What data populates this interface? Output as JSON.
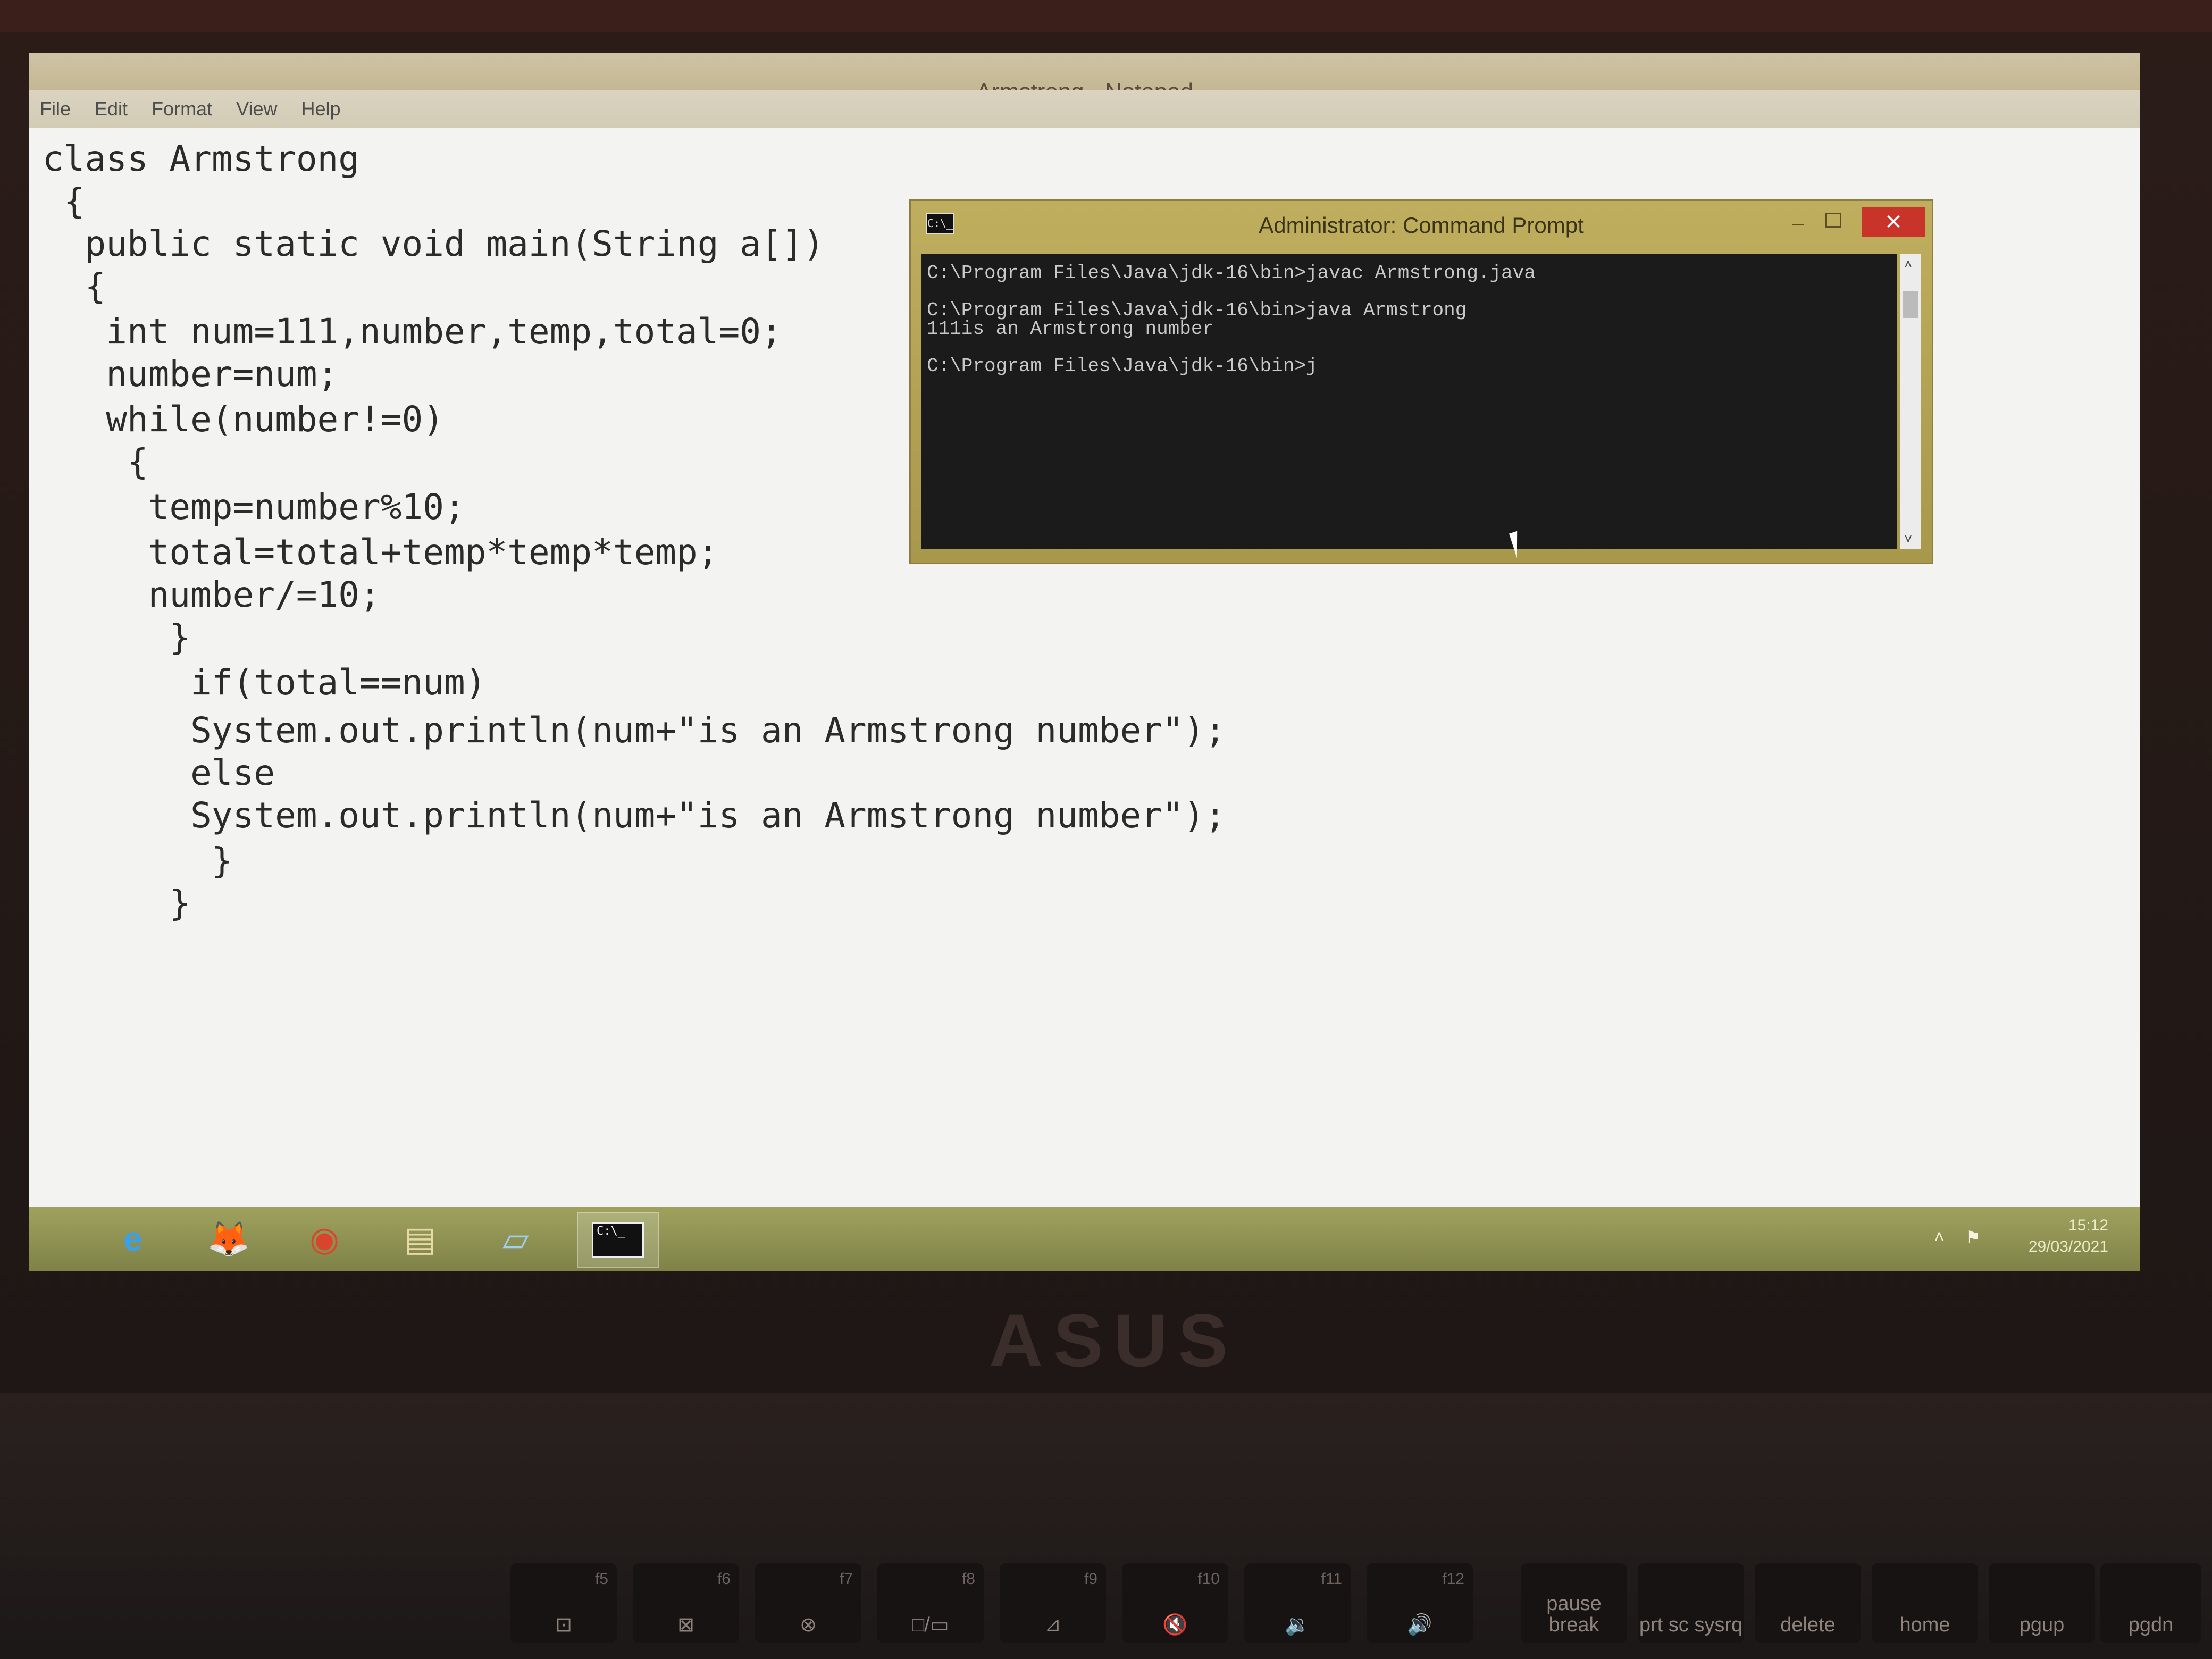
{
  "notepad": {
    "title": "Armstrong - Notepad",
    "menu": [
      "File",
      "Edit",
      "Format",
      "View",
      "Help"
    ],
    "code_lines": [
      "class Armstrong",
      " {",
      "  public static void main(String a[])",
      "  {",
      "   int num=111,number,temp,total=0;",
      "   number=num;",
      "   while(number!=0)",
      "    {",
      "     temp=number%10;",
      "     total=total+temp*temp*temp;",
      "     number/=10;",
      "      }",
      "       if(total==num)",
      "       System.out.println(num+\"is an Armstrong number\");",
      "       else",
      "       System.out.println(num+\"is an Armstrong number\");",
      "        }",
      "      }"
    ]
  },
  "cmd": {
    "title": "Administrator: Command Prompt",
    "icon_label": "C:\\_",
    "close_label": "✕",
    "lines": [
      "C:\\Program Files\\Java\\jdk-16\\bin>javac Armstrong.java",
      "",
      "C:\\Program Files\\Java\\jdk-16\\bin>java Armstrong",
      "111is an Armstrong number",
      "",
      "C:\\Program Files\\Java\\jdk-16\\bin>j"
    ]
  },
  "taskbar": {
    "items": [
      {
        "name": "internet-explorer",
        "glyph": "e"
      },
      {
        "name": "firefox",
        "glyph": "🦊"
      },
      {
        "name": "chrome",
        "glyph": "◉"
      },
      {
        "name": "file-explorer",
        "glyph": "▤"
      },
      {
        "name": "notepad",
        "glyph": "▱"
      },
      {
        "name": "command-prompt",
        "glyph": "C:\\_"
      }
    ],
    "time": "15:12",
    "date": "29/03/2021"
  },
  "brand": "ASUS",
  "keyboard": {
    "keys": [
      {
        "fn": "f5",
        "sym": "⊡"
      },
      {
        "fn": "f6",
        "sym": "⊠"
      },
      {
        "fn": "f7",
        "sym": "⊗"
      },
      {
        "fn": "f8",
        "sym": "□/▭"
      },
      {
        "fn": "f9",
        "sym": "⊿"
      },
      {
        "fn": "f10",
        "sym": "🔇"
      },
      {
        "fn": "f11",
        "sym": "🔉"
      },
      {
        "fn": "f12",
        "sym": "🔊"
      },
      {
        "fn": "",
        "sym": "pause break"
      },
      {
        "fn": "",
        "sym": "prt sc sysrq"
      },
      {
        "fn": "",
        "sym": "delete"
      },
      {
        "fn": "",
        "sym": "home"
      },
      {
        "fn": "",
        "sym": "pgup"
      },
      {
        "fn": "",
        "sym": "pgdn"
      }
    ]
  }
}
